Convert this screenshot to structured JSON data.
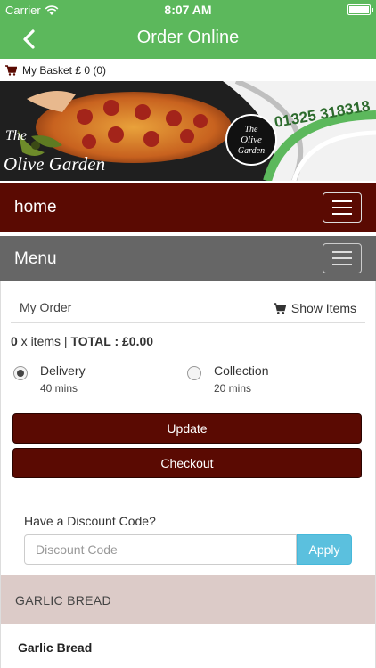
{
  "status_bar": {
    "carrier": "Carrier",
    "time": "8:07 AM"
  },
  "nav": {
    "title": "Order Online",
    "back_icon": "chevron-left-icon"
  },
  "basket": {
    "label": "My Basket £ 0 (0)",
    "icon": "cart-icon"
  },
  "banner": {
    "brand": "The Olive Garden",
    "logo_text": [
      "The",
      "Olive",
      "Garden"
    ],
    "phone": "01325 318318"
  },
  "home_bar": {
    "label": "home"
  },
  "menu_bar": {
    "label": "Menu"
  },
  "order": {
    "heading": "My Order",
    "show_items": "Show Items",
    "item_count": "0",
    "items_label": " x items | ",
    "total_label": "TOTAL : £0.00"
  },
  "delivery_options": [
    {
      "label": "Delivery",
      "time": "40 mins",
      "selected": true
    },
    {
      "label": "Collection",
      "time": "20 mins",
      "selected": false
    }
  ],
  "buttons": {
    "update": "Update",
    "checkout": "Checkout"
  },
  "discount": {
    "question": "Have a Discount Code?",
    "placeholder": "Discount Code",
    "apply": "Apply"
  },
  "category": {
    "name": "GARLIC BREAD"
  },
  "first_item": {
    "name": "Garlic Bread"
  },
  "colors": {
    "header_green": "#5cb85c",
    "maroon": "#5a0a02",
    "menu_grey": "#666666",
    "apply_blue": "#5bc0de",
    "category_bg": "#dccbc8"
  }
}
